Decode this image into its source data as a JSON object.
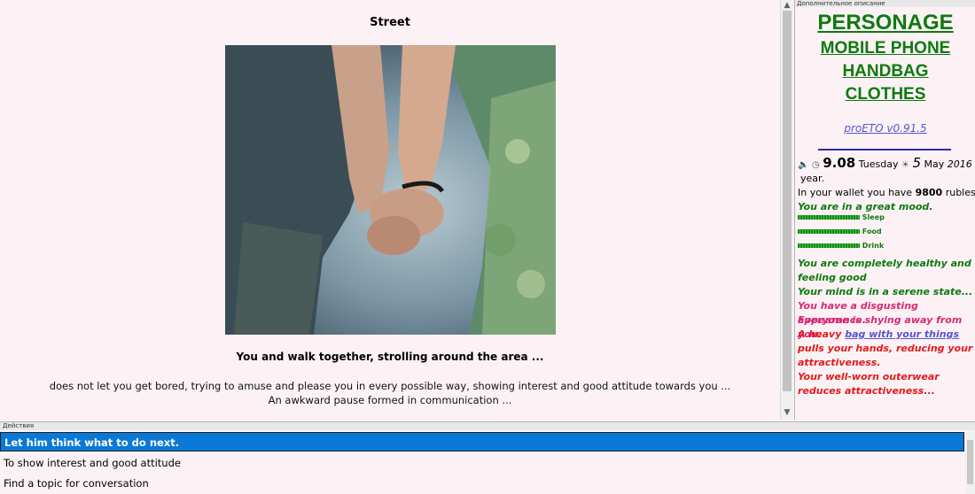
{
  "main": {
    "title": "Street",
    "caption": "You and  walk together, strolling around the area ...",
    "text_line1": "does not let you get bored, trying to amuse and please you in every possible way, showing interest and good attitude towards you ...",
    "text_line2": "An awkward pause formed in communication ..."
  },
  "side": {
    "header": "Дополнительное описание",
    "title": "PERSONAGE",
    "links": [
      "MOBILE PHONE",
      "HANDBAG",
      "CLOTHES"
    ],
    "version": "proETO v0.91.5",
    "time": "9.08",
    "weekday": "Tuesday",
    "day": "5",
    "month": "May",
    "year_num": "2016",
    "year_word": "year.",
    "wallet_prefix": "In your wallet you have",
    "wallet_amount": "9800",
    "wallet_suffix": "rubles",
    "mood": "You are in a great mood.",
    "stats": [
      "Sleep",
      "Food",
      "Drink"
    ],
    "health": "You are completely healthy and feeling good",
    "mind": "Your mind is in a serene state...",
    "appearance": "You have a disgusting appearance.",
    "shying": "Everyone is shying away from you.",
    "bag_pre": "A heavy",
    "bag_link": "bag with your things",
    "bag_post": "pulls your hands, reducing your attractiveness.",
    "outerwear": "Your well-worn outerwear reduces attractiveness..."
  },
  "actions": {
    "header": "Действия",
    "items": [
      "Let him think what to do next.",
      "To show interest and good attitude",
      "Find a topic for conversation"
    ]
  },
  "colors": {
    "accent_green": "#0e7a0e",
    "select_blue": "#0a78d7",
    "pink": "#d62a73",
    "red": "#e21a1a"
  }
}
